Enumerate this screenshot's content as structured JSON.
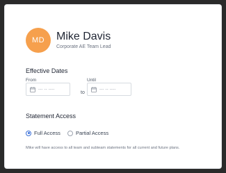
{
  "profile": {
    "initials": "MD",
    "name": "Mike Davis",
    "role": "Corporate AE Team Lead",
    "avatar_color": "#f6a04d"
  },
  "effective_dates": {
    "title": "Effective Dates",
    "from_label": "From",
    "until_label": "Until",
    "from_placeholder": "--- -- ----",
    "until_placeholder": "--- -- ----",
    "separator": "to",
    "icon": "calendar-icon"
  },
  "statement_access": {
    "title": "Statement Access",
    "options": [
      {
        "label": "Full Access",
        "selected": true
      },
      {
        "label": "Partial Access",
        "selected": false
      }
    ],
    "note": "Mike will have access to all team and subteam statements for all current and future plans.",
    "accent": "#3a6fd8"
  }
}
